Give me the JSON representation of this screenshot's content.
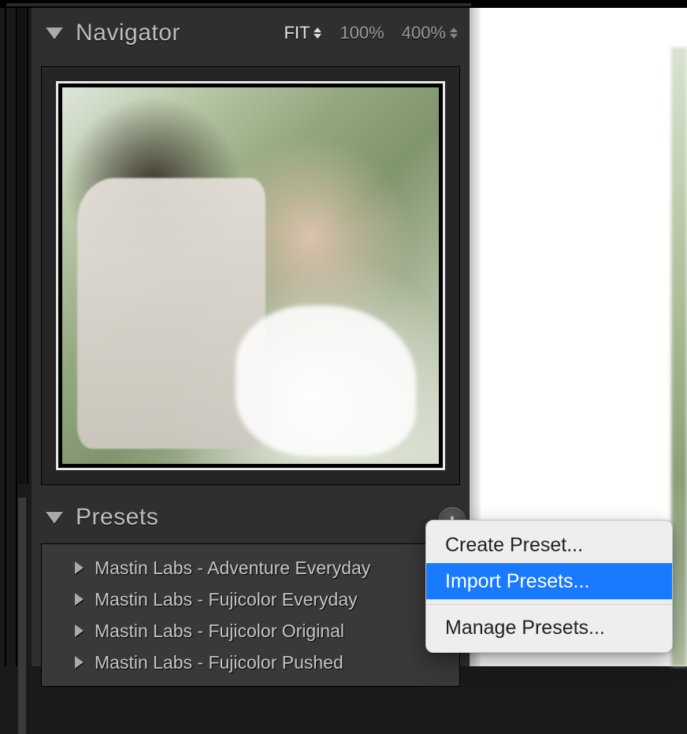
{
  "navigator": {
    "title": "Navigator",
    "zoom": {
      "fit_label": "FIT",
      "z100_label": "100%",
      "z400_label": "400%"
    }
  },
  "presets": {
    "title": "Presets",
    "plus_glyph": "+",
    "items": [
      {
        "label": "Mastin Labs - Adventure Everyday"
      },
      {
        "label": "Mastin Labs - Fujicolor Everyday"
      },
      {
        "label": "Mastin Labs - Fujicolor Original"
      },
      {
        "label": "Mastin Labs - Fujicolor Pushed"
      }
    ]
  },
  "context_menu": {
    "create_label": "Create Preset...",
    "import_label": "Import Presets...",
    "manage_label": "Manage Presets..."
  }
}
